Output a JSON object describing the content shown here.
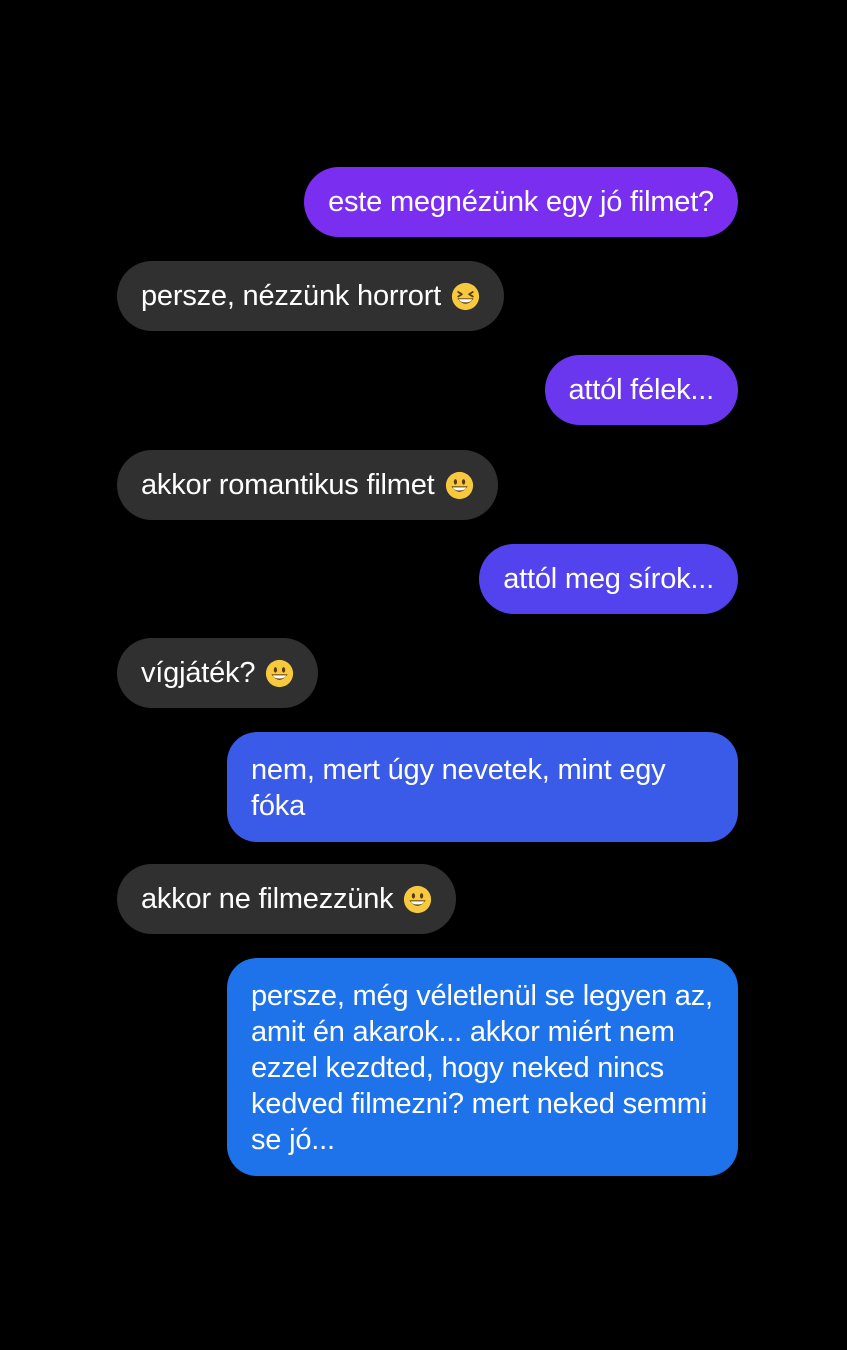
{
  "messages": [
    {
      "id": "m1",
      "side": "outgoing",
      "text": "este megnézünk egy jó filmet?",
      "color": "#7a2ff0"
    },
    {
      "id": "m2",
      "side": "incoming",
      "text": "persze, nézzünk horrort",
      "emoji": "grinning-squinting-face-icon"
    },
    {
      "id": "m3",
      "side": "outgoing",
      "text": "attól félek...",
      "color": "#6a36ee"
    },
    {
      "id": "m4",
      "side": "incoming",
      "text": "akkor romantikus filmet",
      "emoji": "grinning-face-icon"
    },
    {
      "id": "m5",
      "side": "outgoing",
      "text": "attól meg sírok...",
      "color": "#5343ee"
    },
    {
      "id": "m6",
      "side": "incoming",
      "text": "vígjáték?",
      "emoji": "grinning-face-icon"
    },
    {
      "id": "m7",
      "side": "outgoing",
      "text": "nem, mert úgy nevetek, mint egy fóka",
      "color": "#3a5ae8"
    },
    {
      "id": "m8",
      "side": "incoming",
      "text": "akkor ne filmezzünk",
      "emoji": "grinning-face-icon"
    },
    {
      "id": "m9",
      "side": "outgoing",
      "text": "persze, még véletlenül se legyen az, amit én akarok...  akkor miért nem ezzel kezdted, hogy neked nincs kedved filmezni? mert neked semmi se jó...",
      "color": "#1f73ea"
    }
  ],
  "theme": {
    "background": "#000000",
    "incoming_bubble": "#303030",
    "text_color": "#ffffff"
  }
}
